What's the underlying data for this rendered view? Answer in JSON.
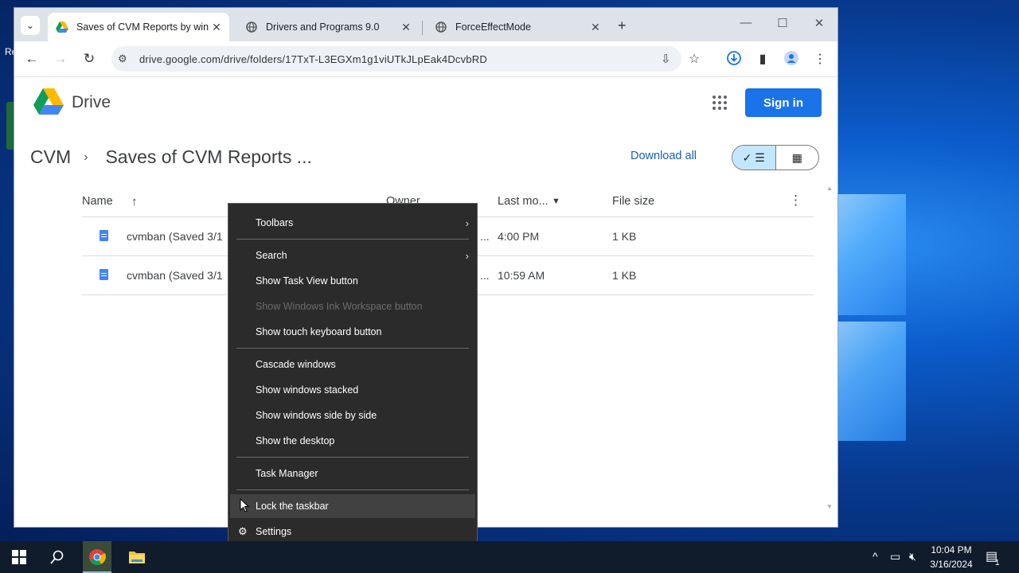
{
  "desktop": {
    "label": "Re"
  },
  "browser": {
    "tabs": [
      {
        "title": "Saves of CVM Reports by winse",
        "active": true
      },
      {
        "title": "Drivers and Programs 9.0",
        "active": false
      },
      {
        "title": "ForceEffectMode",
        "active": false
      }
    ],
    "url": "drive.google.com/drive/folders/17TxT-L3EGXm1g1viUTkJLpEak4DcvbRD"
  },
  "drive": {
    "app_name": "Drive",
    "sign_in_label": "Sign in",
    "breadcrumb": {
      "root": "CVM",
      "current": "Saves of CVM Reports ..."
    },
    "download_all_label": "Download all",
    "columns": {
      "name": "Name",
      "owner": "Owner",
      "last_modified": "Last mo...",
      "file_size": "File size"
    },
    "files": [
      {
        "name": "cvmban (Saved 3/1",
        "owner": "...",
        "modified": "4:00 PM",
        "size": "1 KB"
      },
      {
        "name": "cvmban (Saved 3/1",
        "owner": "...",
        "modified": "10:59 AM",
        "size": "1 KB"
      }
    ]
  },
  "context_menu": {
    "toolbars": "Toolbars",
    "search": "Search",
    "task_view": "Show Task View button",
    "ink_workspace": "Show Windows Ink Workspace button",
    "touch_keyboard": "Show touch keyboard button",
    "cascade": "Cascade windows",
    "stacked": "Show windows stacked",
    "side_by_side": "Show windows side by side",
    "desktop": "Show the desktop",
    "task_manager": "Task Manager",
    "lock_taskbar": "Lock the taskbar",
    "settings": "Settings"
  },
  "taskbar": {
    "time": "10:04 PM",
    "date": "3/16/2024",
    "notification_count": "1"
  },
  "colors": {
    "accent": "#1a73e8",
    "menu_bg": "#2b2b2b",
    "taskbar_bg": "#101c2c"
  }
}
